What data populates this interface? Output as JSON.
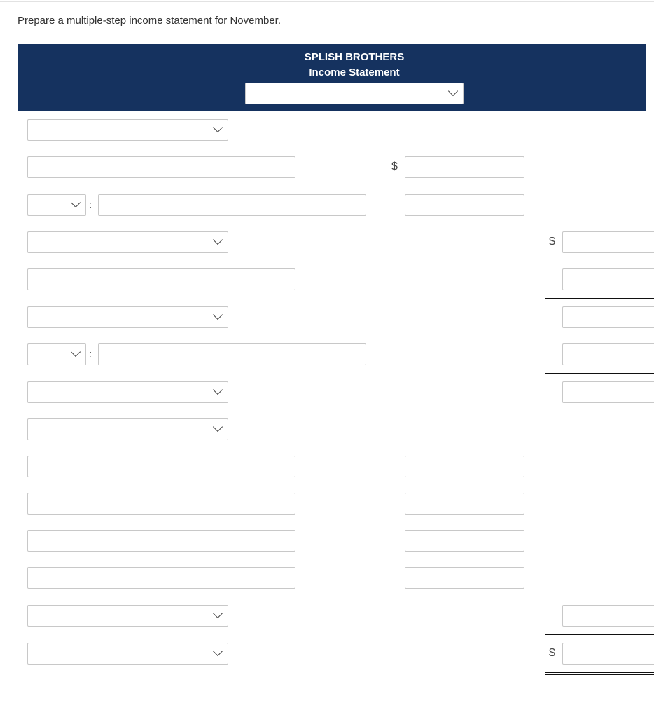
{
  "instruction": "Prepare a multiple-step income statement for November.",
  "header": {
    "company": "SPLISH BROTHERS",
    "statement": "Income Statement",
    "period_select": ""
  },
  "currency_symbol": "$",
  "separator": ":",
  "rows": [
    {
      "left": "select",
      "value": ""
    },
    {
      "left": "text",
      "value": "",
      "mid": "",
      "mid_dollar": true
    },
    {
      "left": "split",
      "value": "",
      "mid": "",
      "rule": "mid"
    },
    {
      "left": "select",
      "value": "",
      "right": "",
      "right_dollar": true
    },
    {
      "left": "text",
      "value": "",
      "right": "",
      "rule": "right"
    },
    {
      "left": "select",
      "value": "",
      "right": ""
    },
    {
      "left": "split",
      "value": "",
      "right": "",
      "rule": "right"
    },
    {
      "left": "select",
      "value": "",
      "right": ""
    },
    {
      "left": "select",
      "value": ""
    },
    {
      "left": "text",
      "value": "",
      "mid": ""
    },
    {
      "left": "text",
      "value": "",
      "mid": ""
    },
    {
      "left": "text",
      "value": "",
      "mid": ""
    },
    {
      "left": "text",
      "value": "",
      "mid": "",
      "rule": "mid"
    },
    {
      "left": "select",
      "value": "",
      "right": "",
      "rule": "right"
    },
    {
      "left": "select",
      "value": "",
      "right": "",
      "right_dollar": true,
      "rule": "right-double"
    }
  ]
}
